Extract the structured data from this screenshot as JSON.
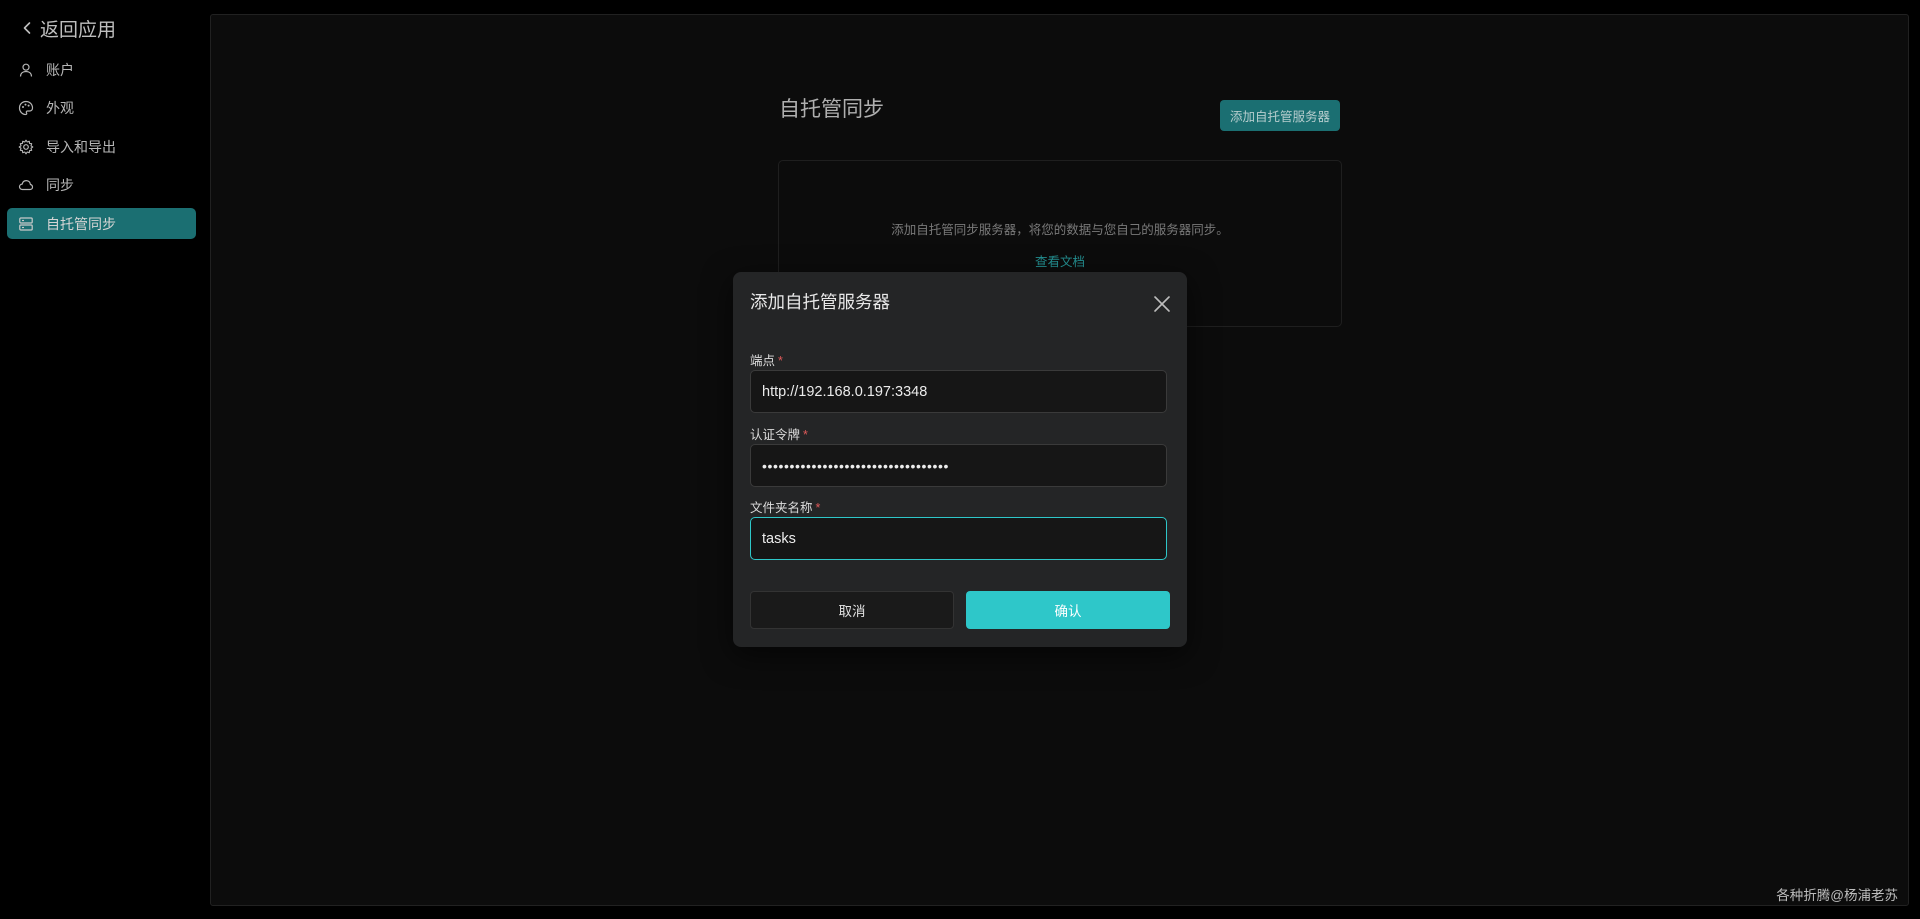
{
  "sidebar": {
    "back_label": "返回应用",
    "items": [
      {
        "label": "账户",
        "icon": "user-icon"
      },
      {
        "label": "外观",
        "icon": "palette-icon"
      },
      {
        "label": "导入和导出",
        "icon": "gear-icon"
      },
      {
        "label": "同步",
        "icon": "cloud-icon"
      },
      {
        "label": "自托管同步",
        "icon": "server-icon",
        "active": true
      }
    ]
  },
  "main": {
    "title": "自托管同步",
    "add_button": "添加自托管服务器",
    "empty_description": "添加自托管同步服务器，将您的数据与您自己的服务器同步。",
    "docs_link": "查看文档"
  },
  "modal": {
    "title": "添加自托管服务器",
    "fields": [
      {
        "label": "端点",
        "value": "http://192.168.0.197:3348"
      },
      {
        "label": "认证令牌",
        "value": "••••••••••••••••••••••••••••••••••"
      },
      {
        "label": "文件夹名称",
        "value": "tasks"
      }
    ],
    "cancel": "取消",
    "confirm": "确认"
  },
  "watermark": "各种折腾@杨浦老苏",
  "colors": {
    "accent": "#2ec7c9",
    "accent_dark": "#1f7f82",
    "required": "#e05a5a",
    "background": "#000000",
    "panel": "#0e0e0e",
    "modal": "#242526"
  }
}
